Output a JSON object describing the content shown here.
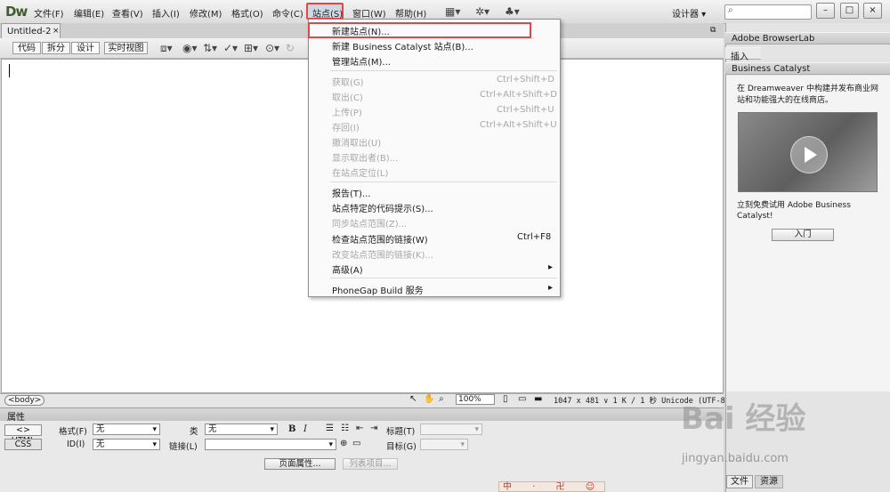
{
  "app": {
    "logo": "Dw",
    "menus": [
      "文件(F)",
      "编辑(E)",
      "查看(V)",
      "插入(I)",
      "修改(M)",
      "格式(O)",
      "命令(C)",
      "站点(S)",
      "窗口(W)",
      "帮助(H)"
    ],
    "workspace": "设计器",
    "window_buttons": [
      "–",
      "□",
      "×"
    ]
  },
  "document": {
    "tab_title": "Untitled-2",
    "tab_close": "×",
    "views": [
      "代码",
      "拆分",
      "设计",
      "实时视图"
    ],
    "active_view": "设计"
  },
  "statusbar": {
    "tag": "<body>",
    "zoom": "100%",
    "info": "1047 x 481 ∨ 1 K / 1 秒 Unicode (UTF-8)"
  },
  "properties": {
    "title": "属性",
    "html_btn": "<> HTML",
    "css_btn": "CSS",
    "format_label": "格式(F)",
    "format_value": "无",
    "id_label": "ID(I)",
    "id_value": "无",
    "class_label": "类",
    "class_value": "无",
    "link_label": "链接(L)",
    "title_label": "标题(T)",
    "target_label": "目标(G)",
    "page_props_btn": "页面属性...",
    "list_item_btn": "列表项目..."
  },
  "right_panel": {
    "browserlab": "Adobe BrowserLab",
    "insert": "插入",
    "bc_title": "Business Catalyst",
    "bc_desc": "在 Dreamweaver 中构建并发布商业网站和功能强大的在线商店。",
    "bc_try": "立刻免费试用 Adobe Business Catalyst!",
    "bc_enter": "入门",
    "tab_files": "文件",
    "tab_assets": "资源"
  },
  "site_menu": {
    "items": [
      {
        "label": "新建站点(N)...",
        "shortcut": "",
        "enabled": true
      },
      {
        "label": "新建 Business Catalyst 站点(B)...",
        "shortcut": "",
        "enabled": true
      },
      {
        "label": "管理站点(M)...",
        "shortcut": "",
        "enabled": true
      },
      {
        "label": "获取(G)",
        "shortcut": "Ctrl+Shift+D",
        "enabled": false
      },
      {
        "label": "取出(C)",
        "shortcut": "Ctrl+Alt+Shift+D",
        "enabled": false
      },
      {
        "label": "上传(P)",
        "shortcut": "Ctrl+Shift+U",
        "enabled": false
      },
      {
        "label": "存回(I)",
        "shortcut": "Ctrl+Alt+Shift+U",
        "enabled": false
      },
      {
        "label": "撤消取出(U)",
        "shortcut": "",
        "enabled": false
      },
      {
        "label": "显示取出者(B)...",
        "shortcut": "",
        "enabled": false
      },
      {
        "label": "在站点定位(L)",
        "shortcut": "",
        "enabled": false
      },
      {
        "label": "报告(T)...",
        "shortcut": "",
        "enabled": true
      },
      {
        "label": "站点特定的代码提示(S)...",
        "shortcut": "",
        "enabled": true
      },
      {
        "label": "同步站点范围(Z)...",
        "shortcut": "",
        "enabled": false
      },
      {
        "label": "检查站点范围的链接(W)",
        "shortcut": "Ctrl+F8",
        "enabled": true
      },
      {
        "label": "改变站点范围的链接(K)...",
        "shortcut": "",
        "enabled": false
      },
      {
        "label": "高级(A)",
        "shortcut": "▸",
        "enabled": true
      },
      {
        "label": "PhoneGap Build 服务",
        "shortcut": "▸",
        "enabled": true
      }
    ]
  },
  "watermark": {
    "logo": "Bai 经验",
    "url": "jingyan.baidu.com",
    "ime": "中 · 卍 ☺"
  }
}
